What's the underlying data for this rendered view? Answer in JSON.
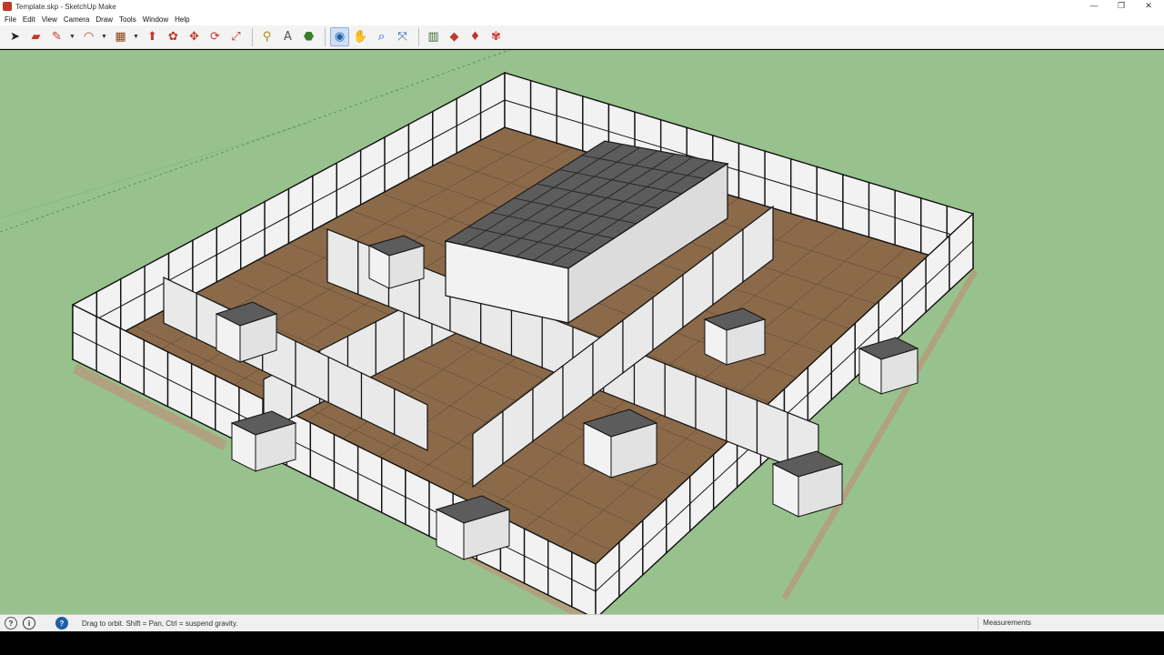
{
  "window": {
    "title": "Template.skp - SketchUp Make",
    "controls": {
      "minimize": "—",
      "restore": "❐",
      "close": "✕"
    }
  },
  "menu": [
    "File",
    "Edit",
    "View",
    "Camera",
    "Draw",
    "Tools",
    "Window",
    "Help"
  ],
  "toolbar": {
    "tools": [
      {
        "icon": "select-arrow-icon",
        "color": "#222222"
      },
      {
        "icon": "eraser-icon",
        "color": "#c0392b"
      },
      {
        "icon": "pencil-line-icon",
        "color": "#c0392b",
        "dropdown": true
      },
      {
        "icon": "arc-icon",
        "color": "#c0392b",
        "dropdown": true
      },
      {
        "icon": "rectangle-icon",
        "color": "#8b4513",
        "dropdown": true
      },
      {
        "icon": "push-pull-icon",
        "color": "#c0392b"
      },
      {
        "icon": "follow-me-icon",
        "color": "#c0392b"
      },
      {
        "icon": "move-icon",
        "color": "#c0392b"
      },
      {
        "icon": "rotate-icon",
        "color": "#c0392b"
      },
      {
        "icon": "scale-icon",
        "color": "#c0392b"
      },
      {
        "icon": "tape-measure-icon",
        "color": "#b8860b"
      },
      {
        "icon": "text-label-icon",
        "color": "#555555"
      },
      {
        "icon": "paint-bucket-icon",
        "color": "#3a7d2c"
      },
      {
        "icon": "orbit-icon",
        "color": "#1f5fa8",
        "active": true
      },
      {
        "icon": "pan-hand-icon",
        "color": "#555555"
      },
      {
        "icon": "zoom-icon",
        "color": "#1f5fa8"
      },
      {
        "icon": "zoom-extents-icon",
        "color": "#1f5fa8"
      },
      {
        "icon": "warehouse-icon",
        "color": "#3a6b2c"
      },
      {
        "icon": "extension-warehouse-icon",
        "color": "#c0392b"
      },
      {
        "icon": "extension-ruby-icon",
        "color": "#c0392b"
      },
      {
        "icon": "share-model-icon",
        "color": "#c0392b"
      }
    ]
  },
  "status": {
    "text": "Drag to orbit. Shift = Pan, Ctrl = suspend gravity.",
    "measurements_label": "Measurements",
    "icons": [
      "geo-location-icon",
      "credits-icon",
      "help-icon"
    ]
  },
  "colors": {
    "ground": "#98c28d",
    "floor": "#8b6a4a",
    "wall": "#f2f2f2",
    "roof": "#5c5c5c"
  }
}
